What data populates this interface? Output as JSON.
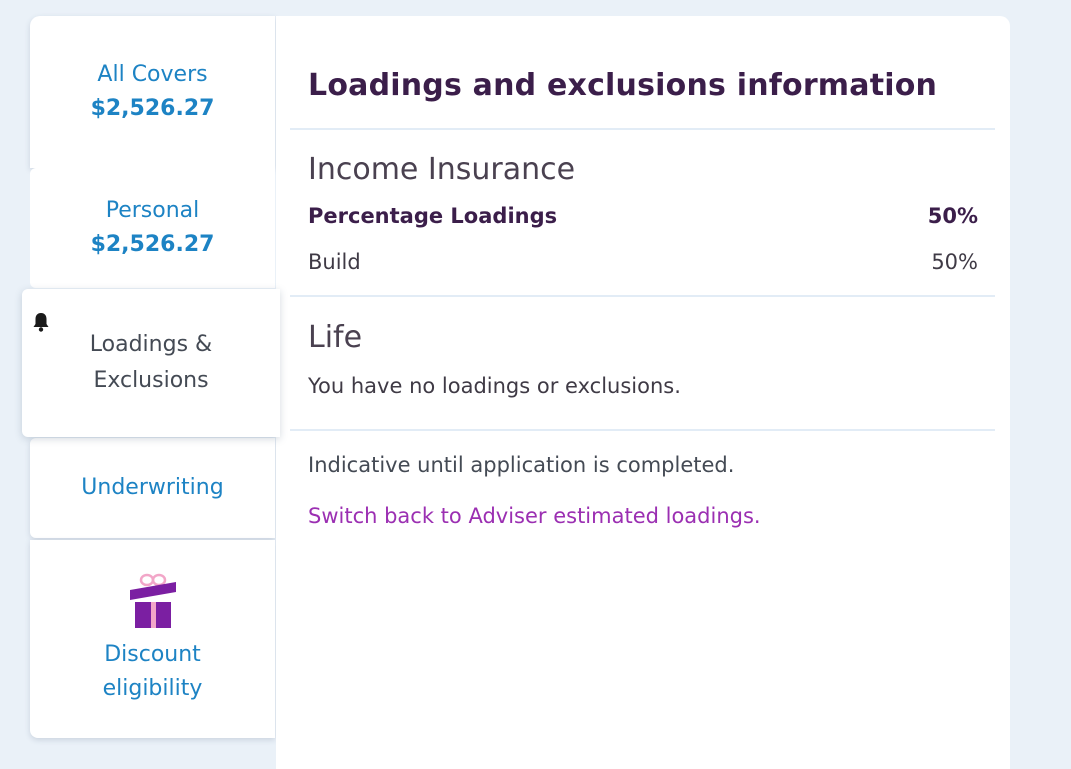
{
  "sidebar": {
    "all_covers": {
      "label": "All Covers",
      "amount": "$2,526.27"
    },
    "personal": {
      "label": "Personal",
      "amount": "$2,526.27"
    },
    "loadings": {
      "label_line1": "Loadings &",
      "label_line2": "Exclusions",
      "icon": "bell-icon"
    },
    "underwriting": {
      "label": "Underwriting"
    },
    "discount": {
      "label_line1": "Discount",
      "label_line2": "eligibility",
      "icon": "gift-icon"
    }
  },
  "panel": {
    "title": "Loadings and exclusions information",
    "income": {
      "heading": "Income Insurance",
      "rows": [
        {
          "label": "Percentage Loadings",
          "value": "50%"
        },
        {
          "label": "Build",
          "value": "50%"
        }
      ]
    },
    "life": {
      "heading": "Life",
      "message": "You have no loadings or exclusions."
    },
    "note": "Indicative until application is completed.",
    "link": "Switch back to Adviser estimated loadings."
  },
  "colors": {
    "accent_blue": "#1d83c4",
    "title_purple": "#3b1e4a",
    "link_purple": "#9b2fb2",
    "gift_purple": "#7b1fa2",
    "background": "#eaf1f8"
  }
}
